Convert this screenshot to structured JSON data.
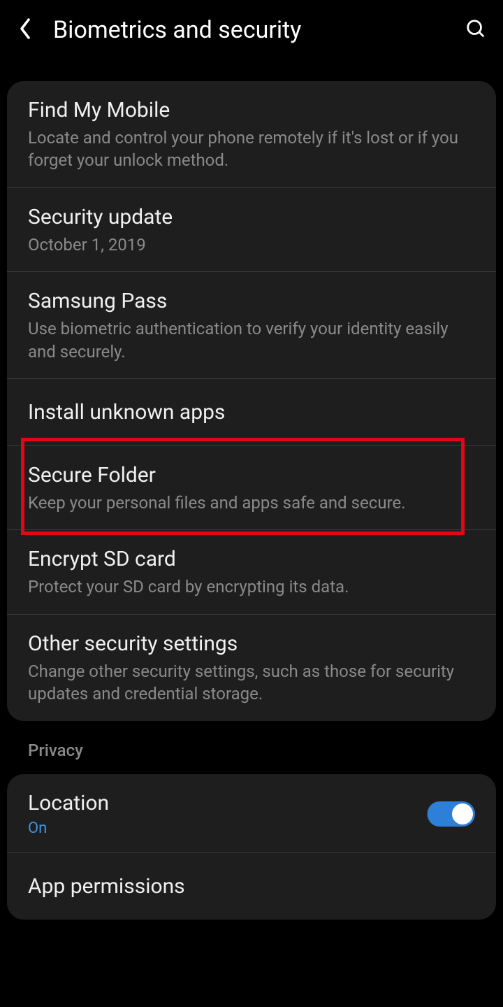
{
  "header": {
    "title": "Biometrics and security"
  },
  "items": [
    {
      "title": "Find My Mobile",
      "subtitle": "Locate and control your phone remotely if it's lost or if you forget your unlock method."
    },
    {
      "title": "Security update",
      "subtitle": "October 1, 2019"
    },
    {
      "title": "Samsung Pass",
      "subtitle": "Use biometric authentication to verify your identity easily and securely."
    },
    {
      "title": "Install unknown apps"
    },
    {
      "title": "Secure Folder",
      "subtitle": "Keep your personal files and apps safe and secure."
    },
    {
      "title": "Encrypt SD card",
      "subtitle": "Protect your SD card by encrypting its data."
    },
    {
      "title": "Other security settings",
      "subtitle": "Change other security settings, such as those for security updates and credential storage."
    }
  ],
  "section_privacy": "Privacy",
  "privacy_items": [
    {
      "title": "Location",
      "status": "On",
      "toggle": true
    },
    {
      "title": "App permissions"
    }
  ]
}
